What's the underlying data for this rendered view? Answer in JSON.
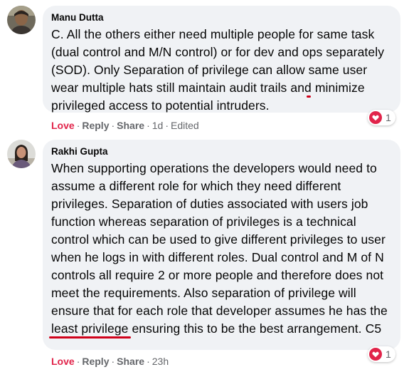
{
  "colors": {
    "love": "#e1244a",
    "highlight": "#d0021b",
    "bubble": "#f0f2f5"
  },
  "comments": [
    {
      "author": "Manu Dutta",
      "text_before": "C. All the others either need multiple people for same task (dual control and M/N control) or for dev and ops separately (SOD). Only Separation of privilege can allow ",
      "text_highlight": "same user wear multiple hats",
      "text_after": " still maintain audit trails and minimize privileged access to potential intruders.",
      "actions": {
        "love": "Love",
        "reply": "Reply",
        "share": "Share",
        "time": "1d",
        "edited": "Edited"
      },
      "reaction_icon": "heart-icon",
      "reaction_count": "1"
    },
    {
      "author": "Rakhi Gupta",
      "text_before": "When supporting operations the developers would need to assume a different role for which they need different privileges. Separation of duties associated with users job function whereas separation of privileges is a technical control which can be used to give different privileges to user when he logs in with different roles. Dual control and M of N controls all require 2 or more people and therefore does not meet the requirements. Also separation of privilege will ensure that for each role that developer assumes he has the ",
      "text_highlight": "least privilege",
      "text_after": " ensuring this to be the best arrangement. C5",
      "actions": {
        "love": "Love",
        "reply": "Reply",
        "share": "Share",
        "time": "23h"
      },
      "reaction_icon": "heart-icon",
      "reaction_count": "1"
    }
  ],
  "separator": "·"
}
